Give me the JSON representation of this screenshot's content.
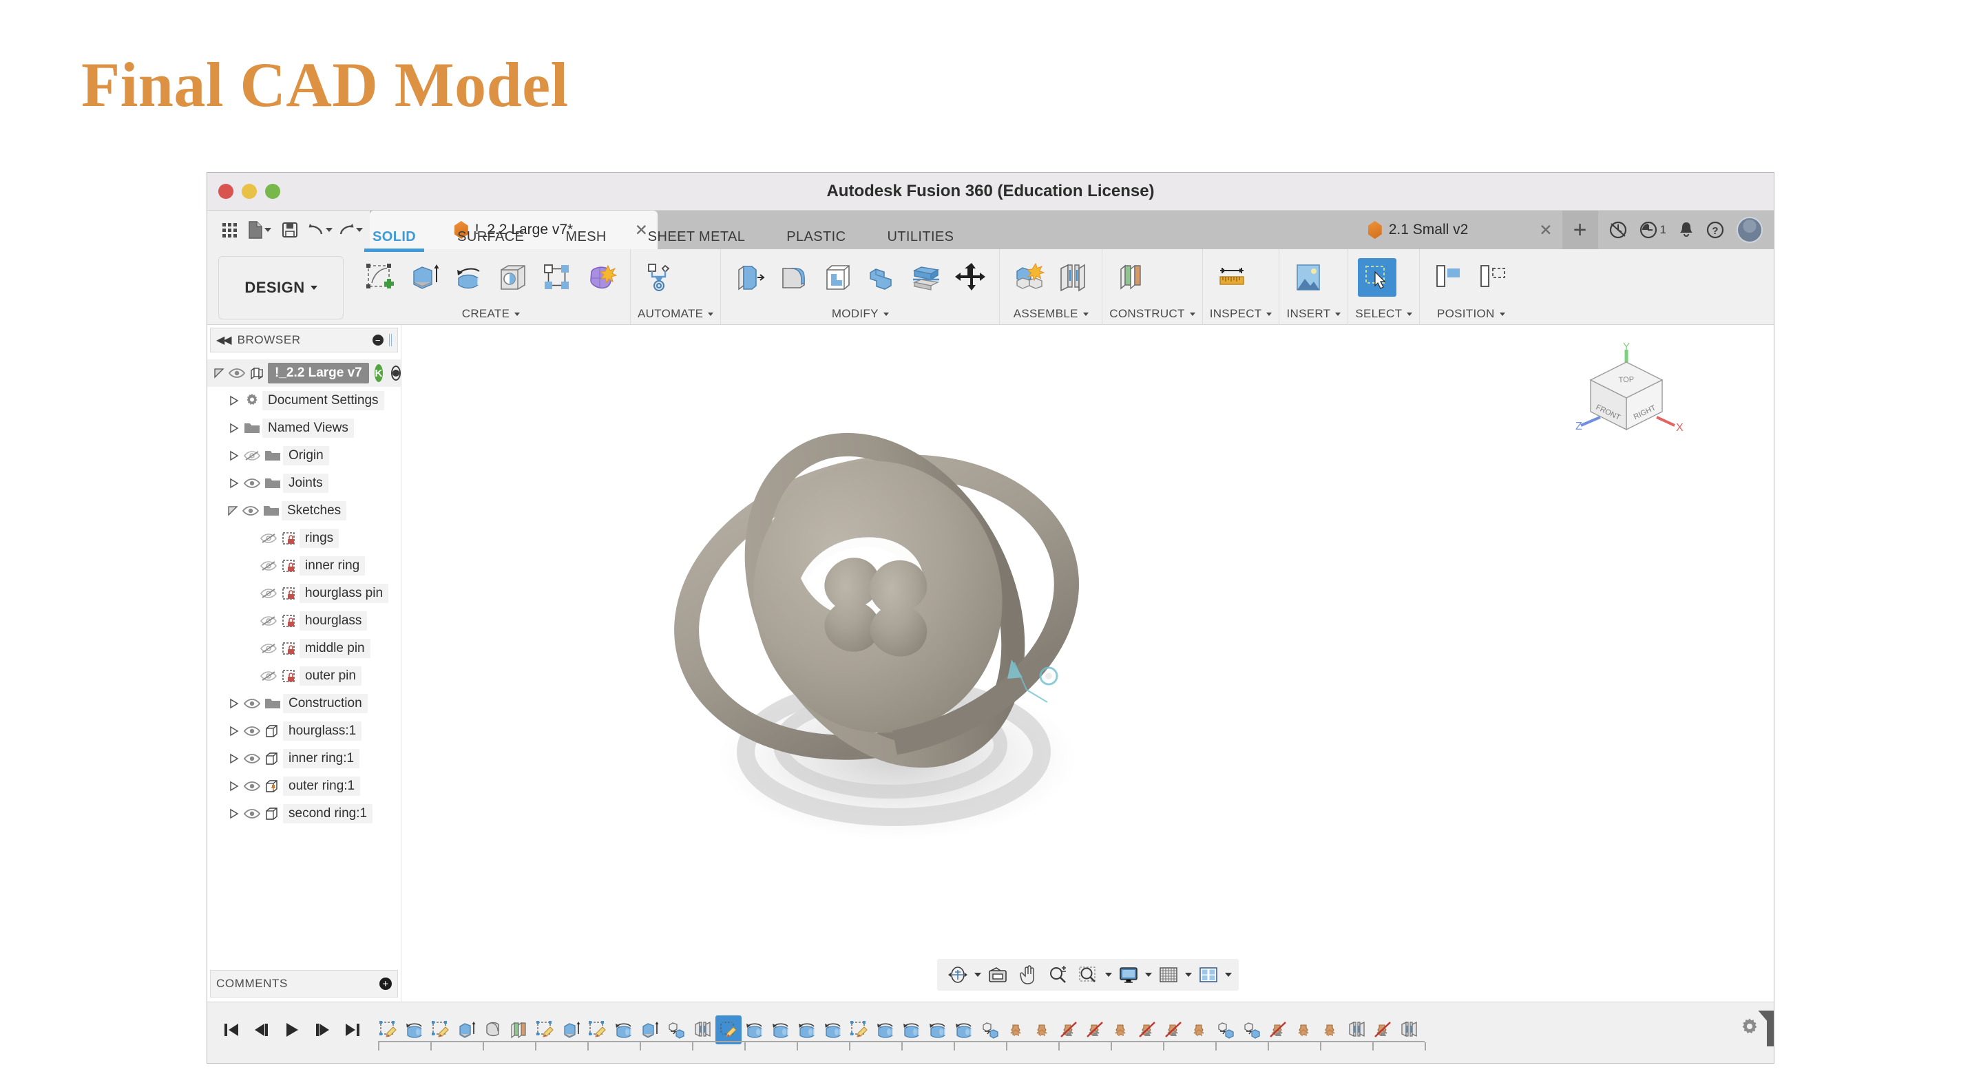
{
  "slide": {
    "title": "Final CAD Model",
    "title_color": "#DD9143",
    "background": "#ffffff"
  },
  "window": {
    "title": "Autodesk Fusion 360 (Education License)",
    "traffic_lights": [
      "close-red",
      "minimize-yellow",
      "maximize-green"
    ]
  },
  "quick_access": {
    "buttons": [
      {
        "name": "app-grid-icon",
        "label": ""
      },
      {
        "name": "file-menu-icon",
        "label": ""
      },
      {
        "name": "save-icon",
        "label": ""
      },
      {
        "name": "undo-icon",
        "label": ""
      },
      {
        "name": "redo-icon",
        "label": ""
      }
    ]
  },
  "document_tabs": [
    {
      "label": "!_2.2 Large v7*",
      "active": true,
      "closeable": true
    },
    {
      "label": "2.1 Small v2",
      "active": false,
      "closeable": true
    }
  ],
  "tab_actions": {
    "new_tab": "+",
    "icons": [
      {
        "name": "job-status-icon",
        "badge": ""
      },
      {
        "name": "recent-activity-icon",
        "badge": "1"
      },
      {
        "name": "notifications-bell-icon",
        "badge": ""
      },
      {
        "name": "help-icon",
        "badge": ""
      },
      {
        "name": "user-avatar",
        "badge": ""
      }
    ]
  },
  "workspace": {
    "selector_label": "DESIGN"
  },
  "environment_tabs": [
    {
      "label": "SOLID",
      "active": true
    },
    {
      "label": "SURFACE",
      "active": false
    },
    {
      "label": "MESH",
      "active": false
    },
    {
      "label": "SHEET METAL",
      "active": false
    },
    {
      "label": "PLASTIC",
      "active": false
    },
    {
      "label": "UTILITIES",
      "active": false
    }
  ],
  "ribbon_groups": [
    {
      "label": "CREATE",
      "icons": [
        "create-sketch-icon",
        "extrude-icon",
        "revolve-icon",
        "hole-icon",
        "pattern-icon",
        "form-icon"
      ]
    },
    {
      "label": "AUTOMATE",
      "icons": [
        "automated-modeling-icon"
      ]
    },
    {
      "label": "MODIFY",
      "icons": [
        "press-pull-icon",
        "fillet-icon",
        "shell-icon",
        "combine-icon",
        "split-face-icon",
        "move-copy-icon"
      ]
    },
    {
      "label": "ASSEMBLE",
      "icons": [
        "new-component-icon",
        "joint-icon"
      ]
    },
    {
      "label": "CONSTRUCT",
      "icons": [
        "offset-plane-icon"
      ]
    },
    {
      "label": "INSPECT",
      "icons": [
        "measure-icon"
      ]
    },
    {
      "label": "INSERT",
      "icons": [
        "insert-image-icon"
      ]
    },
    {
      "label": "SELECT",
      "icons": [
        "select-window-icon"
      ],
      "active": true
    },
    {
      "label": "POSITION",
      "icons": [
        "align-icon",
        "position-icon"
      ]
    }
  ],
  "browser": {
    "header": "BROWSER",
    "tree": [
      {
        "label": "!_2.2 Large v7",
        "depth": 0,
        "expanded": true,
        "visible": true,
        "icon": "component-icon",
        "selected": true,
        "badge": "K",
        "activity_dot": true
      },
      {
        "label": "Document Settings",
        "depth": 1,
        "expanded": false,
        "visible": null,
        "icon": "gear-icon"
      },
      {
        "label": "Named Views",
        "depth": 1,
        "expanded": false,
        "visible": null,
        "icon": "folder-icon"
      },
      {
        "label": "Origin",
        "depth": 1,
        "expanded": false,
        "visible": false,
        "icon": "folder-icon"
      },
      {
        "label": "Joints",
        "depth": 1,
        "expanded": false,
        "visible": true,
        "icon": "folder-icon"
      },
      {
        "label": "Sketches",
        "depth": 1,
        "expanded": true,
        "visible": true,
        "icon": "folder-icon"
      },
      {
        "label": "rings",
        "depth": 2,
        "expanded": null,
        "visible": false,
        "icon": "sketch-locked-icon"
      },
      {
        "label": "inner ring",
        "depth": 2,
        "expanded": null,
        "visible": false,
        "icon": "sketch-locked-icon"
      },
      {
        "label": "hourglass pin",
        "depth": 2,
        "expanded": null,
        "visible": false,
        "icon": "sketch-locked-icon"
      },
      {
        "label": "hourglass",
        "depth": 2,
        "expanded": null,
        "visible": false,
        "icon": "sketch-locked-icon"
      },
      {
        "label": "middle pin",
        "depth": 2,
        "expanded": null,
        "visible": false,
        "icon": "sketch-locked-icon"
      },
      {
        "label": "outer pin",
        "depth": 2,
        "expanded": null,
        "visible": false,
        "icon": "sketch-locked-icon"
      },
      {
        "label": "Construction",
        "depth": 1,
        "expanded": false,
        "visible": true,
        "icon": "folder-icon"
      },
      {
        "label": "hourglass:1",
        "depth": 1,
        "expanded": false,
        "visible": true,
        "icon": "body-icon"
      },
      {
        "label": "inner ring:1",
        "depth": 1,
        "expanded": false,
        "visible": true,
        "icon": "body-icon"
      },
      {
        "label": "outer ring:1",
        "depth": 1,
        "expanded": false,
        "visible": true,
        "icon": "body-pinned-icon"
      },
      {
        "label": "second ring:1",
        "depth": 1,
        "expanded": false,
        "visible": true,
        "icon": "body-icon"
      }
    ],
    "comments_label": "COMMENTS"
  },
  "viewcube": {
    "faces": {
      "top": "TOP",
      "front": "FRONT",
      "right": "RIGHT"
    },
    "axes": [
      {
        "label": "X",
        "color": "#e06464"
      },
      {
        "label": "Y",
        "color": "#7cd17c"
      },
      {
        "label": "Z",
        "color": "#6f8fe0"
      }
    ]
  },
  "model": {
    "name": "gimbal-hourglass-model",
    "body_color": "#a39c91",
    "shadow_color": "#d8d8d8"
  },
  "nav_bar": {
    "buttons": [
      {
        "name": "orbit-icon",
        "has_caret": true
      },
      {
        "name": "look-at-icon",
        "has_caret": false
      },
      {
        "name": "pan-icon",
        "has_caret": false
      },
      {
        "name": "zoom-icon",
        "has_caret": false
      },
      {
        "name": "zoom-window-icon",
        "has_caret": true
      },
      {
        "name": "display-settings-icon",
        "has_caret": true
      },
      {
        "name": "grid-snaps-icon",
        "has_caret": true
      },
      {
        "name": "viewports-icon",
        "has_caret": true
      }
    ]
  },
  "timeline": {
    "playback": [
      "go-to-beginning-icon",
      "step-back-icon",
      "play-icon",
      "step-forward-icon",
      "go-to-end-icon"
    ],
    "features": [
      {
        "icon": "sketch-icon",
        "selected": false
      },
      {
        "icon": "revolve-icon",
        "selected": false
      },
      {
        "icon": "sketch-icon",
        "selected": false
      },
      {
        "icon": "extrude-icon",
        "selected": false
      },
      {
        "icon": "loft-icon",
        "selected": false
      },
      {
        "icon": "offset-plane-icon",
        "selected": false
      },
      {
        "icon": "sketch-icon",
        "selected": false
      },
      {
        "icon": "extrude-icon",
        "selected": false
      },
      {
        "icon": "sketch-icon",
        "selected": false
      },
      {
        "icon": "revolve-icon",
        "selected": false
      },
      {
        "icon": "extrude-icon",
        "selected": false
      },
      {
        "icon": "new-component-icon",
        "selected": false
      },
      {
        "icon": "mirror-icon",
        "selected": false
      },
      {
        "icon": "sketch-icon",
        "selected": true
      },
      {
        "icon": "revolve-icon",
        "selected": false
      },
      {
        "icon": "revolve-icon",
        "selected": false
      },
      {
        "icon": "revolve-icon",
        "selected": false
      },
      {
        "icon": "revolve-icon",
        "selected": false
      },
      {
        "icon": "sketch-icon",
        "selected": false
      },
      {
        "icon": "revolve-icon",
        "selected": false
      },
      {
        "icon": "revolve-icon",
        "selected": false
      },
      {
        "icon": "revolve-icon",
        "selected": false
      },
      {
        "icon": "revolve-icon",
        "selected": false
      },
      {
        "icon": "new-component-icon",
        "selected": false
      },
      {
        "icon": "joint-icon",
        "selected": false
      },
      {
        "icon": "joint-icon",
        "selected": false
      },
      {
        "icon": "joint-suppressed-icon",
        "selected": false
      },
      {
        "icon": "joint-suppressed-icon",
        "selected": false
      },
      {
        "icon": "joint-icon",
        "selected": false
      },
      {
        "icon": "joint-suppressed-icon",
        "selected": false
      },
      {
        "icon": "joint-suppressed-icon",
        "selected": false
      },
      {
        "icon": "joint-icon",
        "selected": false
      },
      {
        "icon": "new-component-icon",
        "selected": false
      },
      {
        "icon": "new-component-icon",
        "selected": false
      },
      {
        "icon": "joint-suppressed-icon",
        "selected": false
      },
      {
        "icon": "joint-icon",
        "selected": false
      },
      {
        "icon": "joint-icon",
        "selected": false
      },
      {
        "icon": "mirror-icon",
        "selected": false
      },
      {
        "icon": "joint-suppressed-icon",
        "selected": false
      },
      {
        "icon": "mirror-icon",
        "selected": false
      }
    ],
    "settings_icon": "gear-icon"
  }
}
